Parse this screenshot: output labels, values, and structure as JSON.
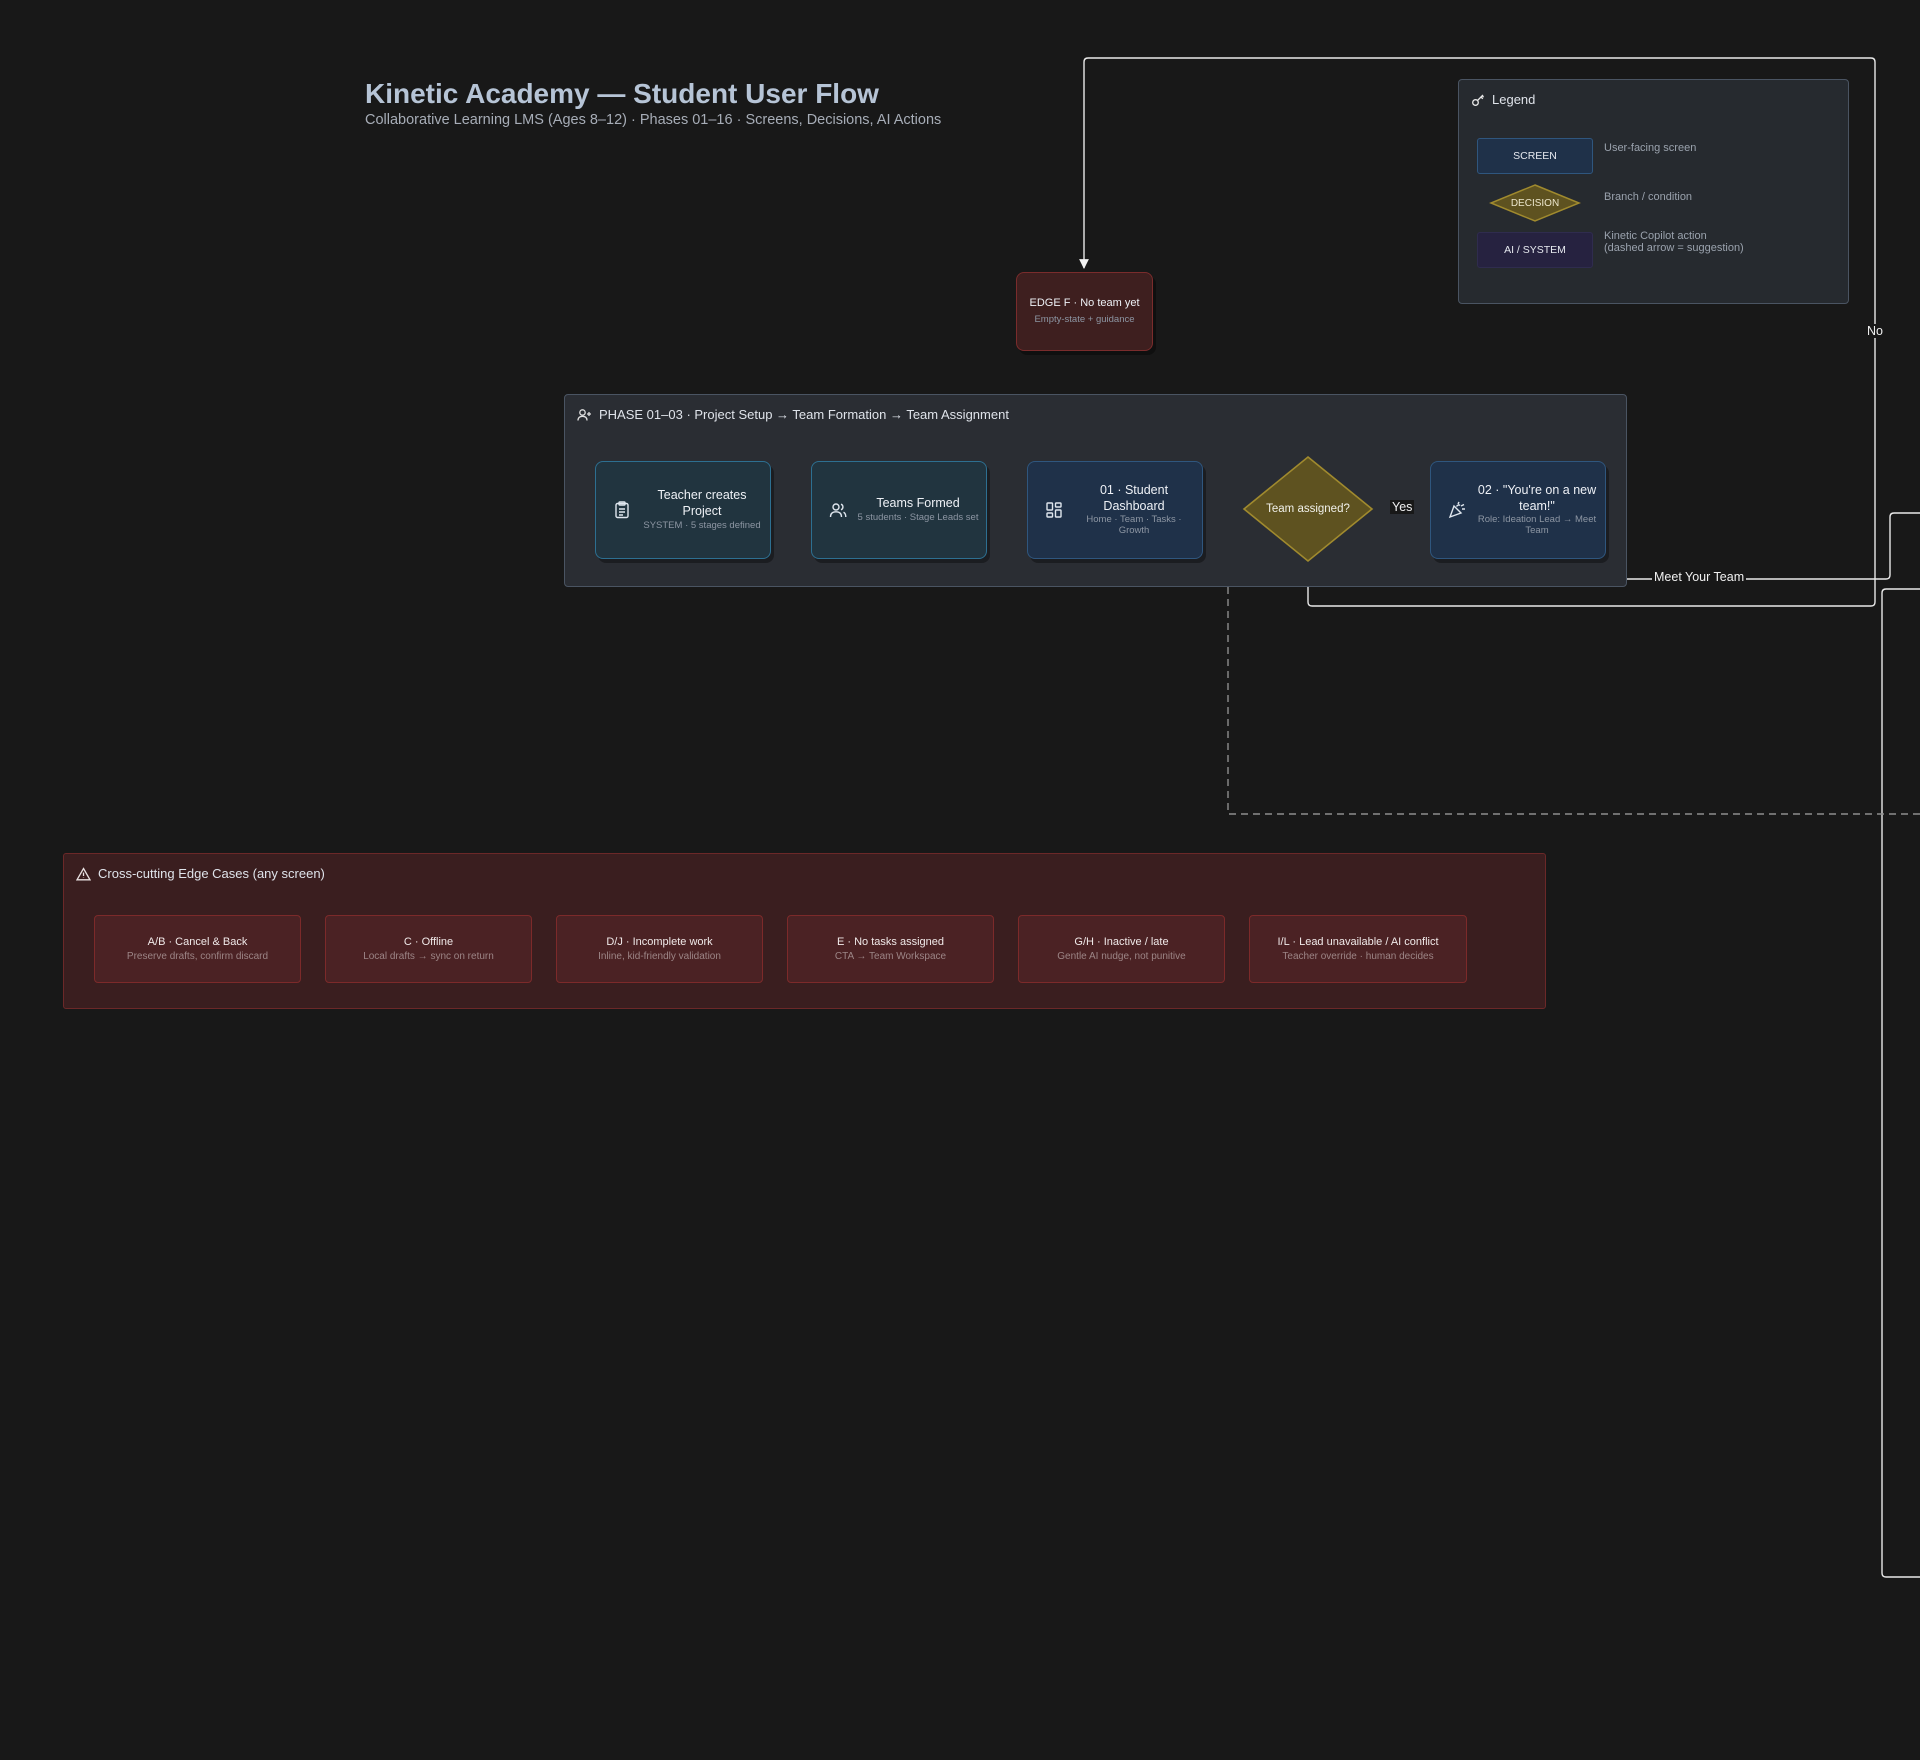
{
  "header": {
    "title": "Kinetic Academy — Student User Flow",
    "subtitle": "Collaborative Learning LMS (Ages 8–12) · Phases 01–16 · Screens, Decisions, AI Actions"
  },
  "legend": {
    "title": "Legend",
    "items": [
      {
        "shape": "SCREEN",
        "description": "User-facing screen"
      },
      {
        "shape": "DECISION",
        "description": "Branch / condition"
      },
      {
        "shape": "AI / SYSTEM",
        "description_line1": "Kinetic Copilot action",
        "description_line2": "(dashed arrow = suggestion)"
      }
    ]
  },
  "edge_f": {
    "title": "EDGE F · No team yet",
    "subtitle": "Empty-state + guidance"
  },
  "phase": {
    "title": "PHASE 01–03 · Project Setup → Team Formation → Team Assignment",
    "nodes": [
      {
        "title": "Teacher creates Project",
        "subtitle": "SYSTEM · 5 stages defined",
        "icon": "clipboard-icon"
      },
      {
        "title": "Teams Formed",
        "subtitle": "5 students · Stage Leads set",
        "icon": "users-icon"
      },
      {
        "title": "01 · Student Dashboard",
        "subtitle": "Home · Team · Tasks · Growth",
        "icon": "dashboard-icon"
      },
      {
        "title": "02 · \"You're on a new team!\"",
        "subtitle": "Role: Ideation Lead → Meet Team",
        "icon": "party-icon"
      }
    ],
    "decision": "Team assigned?"
  },
  "edge_labels": {
    "yes": "Yes",
    "no": "No",
    "meet": "Meet Your Team"
  },
  "edge_cases": {
    "title": "Cross-cutting Edge Cases (any screen)",
    "cards": [
      {
        "title": "A/B · Cancel & Back",
        "subtitle": "Preserve drafts, confirm discard"
      },
      {
        "title": "C · Offline",
        "subtitle": "Local drafts → sync on return"
      },
      {
        "title": "D/J · Incomplete work",
        "subtitle": "Inline, kid-friendly validation"
      },
      {
        "title": "E · No tasks assigned",
        "subtitle": "CTA → Team Workspace"
      },
      {
        "title": "G/H · Inactive / late",
        "subtitle": "Gentle AI nudge, not punitive"
      },
      {
        "title": "I/L · Lead unavailable / AI conflict",
        "subtitle": "Teacher override · human decides"
      }
    ]
  },
  "colors": {
    "background": "#181818",
    "screen_fill": "#1f3149",
    "system_fill": "#21343f",
    "decision_fill": "#5e5220",
    "edge_fill": "#3e1f1f",
    "ai_fill": "#262240"
  }
}
